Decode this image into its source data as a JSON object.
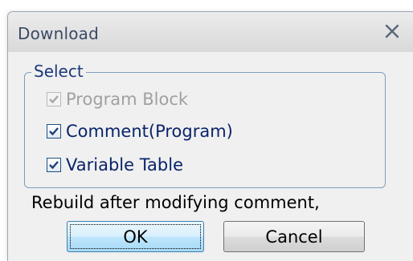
{
  "dialog": {
    "title": "Download",
    "close_icon": "close-x-icon"
  },
  "select_group": {
    "legend": "Select",
    "options": [
      {
        "label": "Program Block",
        "checked": true,
        "disabled": true
      },
      {
        "label": "Comment(Program)",
        "checked": true,
        "disabled": false
      },
      {
        "label": "Variable Table",
        "checked": true,
        "disabled": false
      }
    ]
  },
  "note": "Rebuild after modifying comment,",
  "buttons": {
    "ok_label": "OK",
    "cancel_label": "Cancel"
  },
  "colors": {
    "title_text": "#3b4a63",
    "group_text": "#0a246a",
    "disabled_text": "#a0a0a0",
    "group_border": "#7f9db9"
  }
}
